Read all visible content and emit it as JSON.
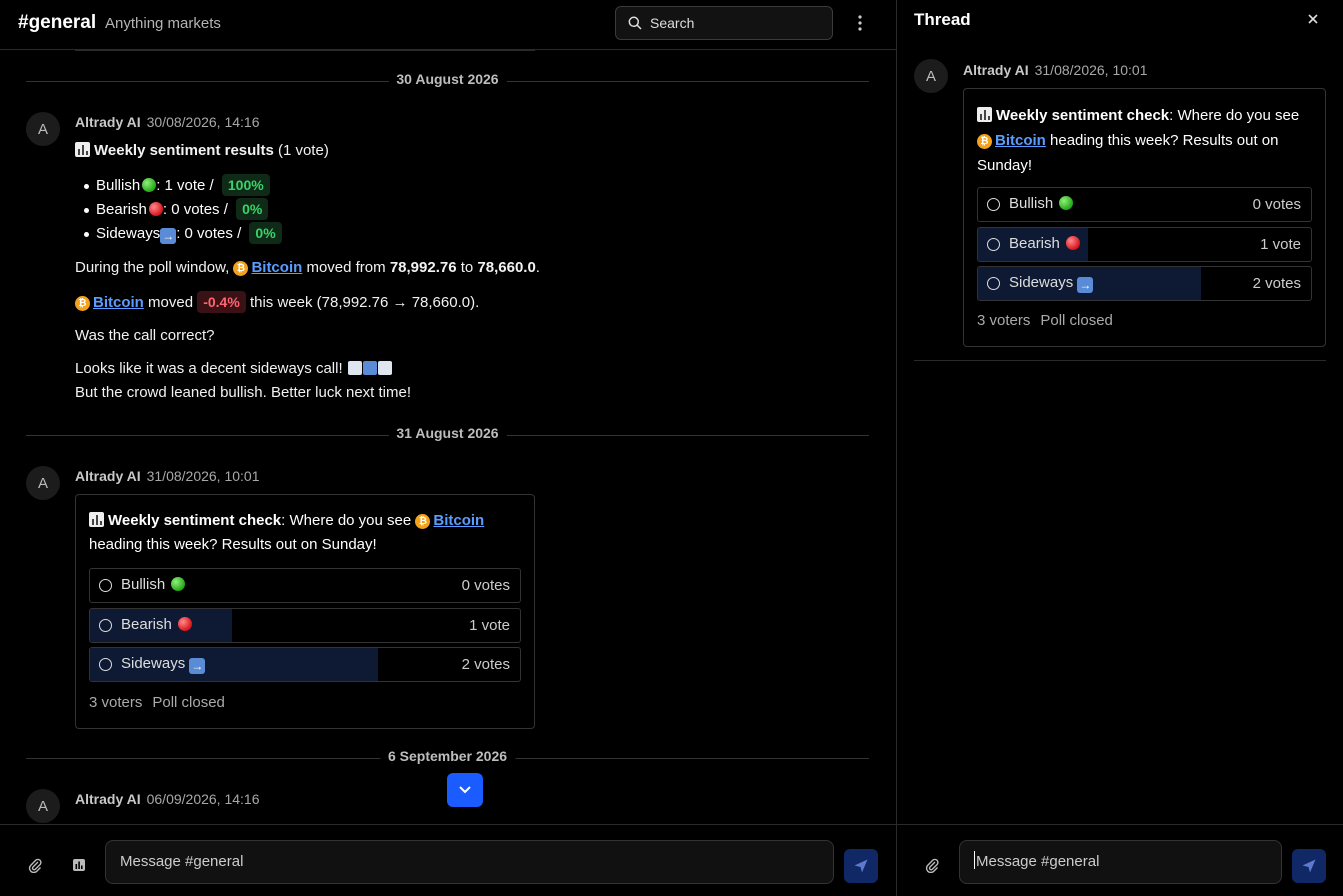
{
  "header": {
    "channel": "#general",
    "description": "Anything markets",
    "search_label": "Search"
  },
  "icons": {
    "search": "search-icon",
    "more": "kebab-menu-icon",
    "attach": "paperclip-icon",
    "poll": "poll-chart-icon",
    "send": "send-icon",
    "close": "close-icon",
    "scroll_down": "chevron-down-icon",
    "bitcoin": "bitcoin-icon"
  },
  "colors": {
    "accent": "#1a5cff",
    "link": "#5b9dff",
    "positive": "#39d369",
    "negative": "#ff6470",
    "poll_fill": "#0e1a33"
  },
  "messages": {
    "sep1": "30 August 2026",
    "m1": {
      "avatar": "A",
      "author": "Altrady AI",
      "time": "30/08/2026, 14:16",
      "title": "Weekly sentiment results",
      "title_suffix": " (1 vote)",
      "results": [
        {
          "label": "Bullish",
          "mid": ": 1 vote / ",
          "pct": "100%"
        },
        {
          "label": "Bearish",
          "mid": ": 0 votes / ",
          "pct": "0%"
        },
        {
          "label": "Sideways",
          "mid": ": 0 votes / ",
          "pct": "0%"
        }
      ],
      "line1_a": "During the poll window, ",
      "line1_link": "Bitcoin",
      "line1_b": " moved from ",
      "line1_from": "78,992.76",
      "line1_c": " to ",
      "line1_to": "78,660.0",
      "line1_d": ".",
      "line2_link": "Bitcoin",
      "line2_a": " moved ",
      "line2_change": "-0.4%",
      "line2_b": " this week (78,992.76 → 78,660.0).",
      "question": "Was the call correct?",
      "comment1": "Looks like it was a decent sideways call! ",
      "comment2": "But the crowd leaned bullish. Better luck next time!"
    },
    "sep2": "31 August 2026",
    "m2": {
      "avatar": "A",
      "author": "Altrady AI",
      "time": "31/08/2026, 10:01"
    },
    "sep3": "6 September 2026",
    "m3": {
      "avatar": "A",
      "author": "Altrady AI",
      "time": "06/09/2026, 14:16"
    }
  },
  "poll": {
    "title": "Weekly sentiment check",
    "q_a": ": Where do you see ",
    "link": "Bitcoin",
    "q_b": " heading this week? Results out on Sunday!",
    "q_b1": "heading this week? Results out on Sunday!",
    "q_b_thread_1": " heading this week? Results out on",
    "q_b_thread_2": "Sunday!",
    "options": [
      {
        "label": "Bullish",
        "votes": "0 votes",
        "share": 0
      },
      {
        "label": "Bearish",
        "votes": "1 vote",
        "share": 0.33
      },
      {
        "label": "Sideways",
        "votes": "2 votes",
        "share": 0.67
      }
    ],
    "voters": "3 voters",
    "status": "Poll closed"
  },
  "composer": {
    "placeholder": "Message #general"
  },
  "thread": {
    "title": "Thread",
    "avatar": "A",
    "author": "Altrady AI",
    "time": "31/08/2026, 10:01",
    "placeholder": "Message #general"
  }
}
